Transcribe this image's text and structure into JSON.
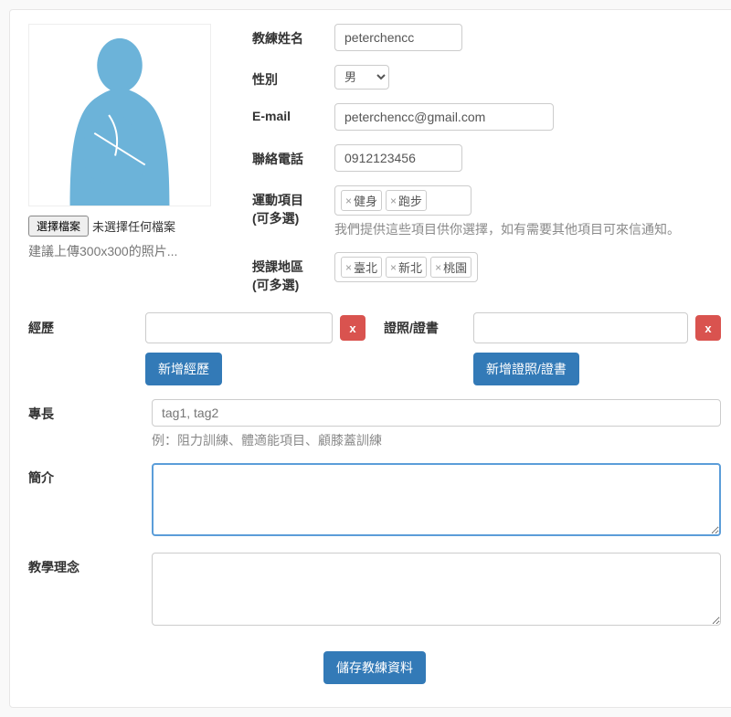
{
  "photo": {
    "choose_file_label": "選擇檔案",
    "no_file_text": "未選擇任何檔案",
    "hint": "建議上傳300x300的照片..."
  },
  "fields": {
    "name_label": "教練姓名",
    "name_value": "peterchencc",
    "gender_label": "性別",
    "gender_value": "男",
    "email_label": "E-mail",
    "email_value": "peterchencc@gmail.com",
    "phone_label": "聯絡電話",
    "phone_value": "0912123456",
    "sports_label": "運動項目",
    "sports_sub": "(可多選)",
    "sports_tags": [
      "健身",
      "跑步"
    ],
    "sports_hint": "我們提供這些項目供你選擇，如有需要其他項目可來信通知。",
    "areas_label": "授課地區",
    "areas_sub": "(可多選)",
    "areas_tags": [
      "臺北",
      "新北",
      "桃園"
    ]
  },
  "experience": {
    "label": "經歷",
    "add_btn": "新增經歷",
    "value": ""
  },
  "certs": {
    "label": "證照/證書",
    "add_btn": "新增證照/證書",
    "value": ""
  },
  "specialty": {
    "label": "專長",
    "placeholder": "tag1, tag2",
    "hint": "例：阻力訓練、體適能項目、顧膝蓋訓練"
  },
  "bio": {
    "label": "簡介",
    "value": ""
  },
  "philosophy": {
    "label": "教學理念",
    "value": ""
  },
  "submit": {
    "label": "儲存教練資料"
  },
  "tag_x": "×"
}
